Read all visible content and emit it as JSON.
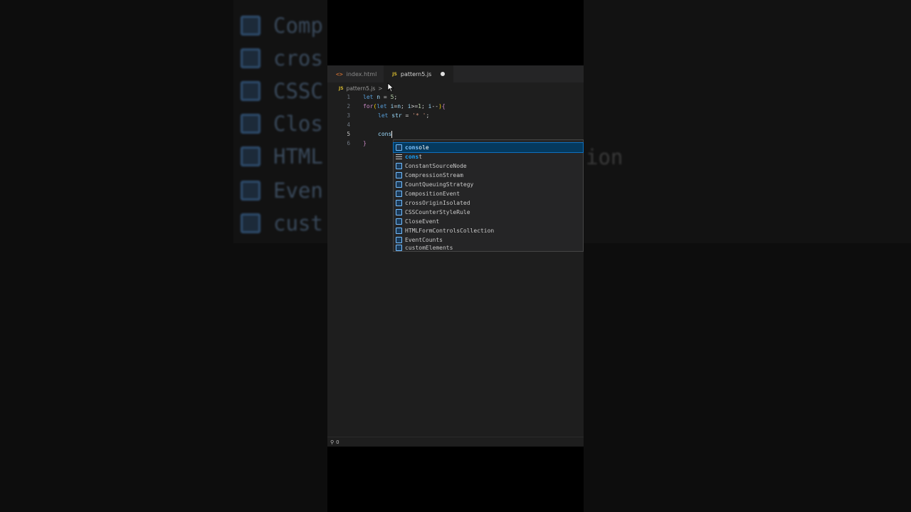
{
  "background_zoom": {
    "items": [
      "Comp",
      "cros",
      "CSSC",
      "Clos",
      "HTML",
      "Even",
      "cust"
    ],
    "trail_text": "ion"
  },
  "tabs": [
    {
      "label": "index.html",
      "icon": "html-icon",
      "active": false
    },
    {
      "label": "pattern5.js",
      "icon": "js-icon",
      "active": true,
      "unsaved": true
    }
  ],
  "breadcrumb": {
    "icon": "JS",
    "file": "pattern5.js",
    "separator": ">"
  },
  "js_icon_text": "JS",
  "code_lines": [
    {
      "num": "1"
    },
    {
      "num": "2"
    },
    {
      "num": "3"
    },
    {
      "num": "4"
    },
    {
      "num": "5"
    },
    {
      "num": "6"
    }
  ],
  "code_tokens": {
    "l1_let": "let",
    "l1_n": "n",
    "l1_eq": " = ",
    "l1_five": "5",
    "l1_semi": ";",
    "l2_for": "for",
    "l2_open": "(",
    "l2_let": "let",
    "l2_i1": "i",
    "l2_eqn": "=",
    "l2_n": "n",
    "l2_s1": "; ",
    "l2_i2": "i",
    "l2_ge": ">=",
    "l2_one": "1",
    "l2_s2": "; ",
    "l2_i3": "i",
    "l2_dec": "--",
    "l2_close": ")",
    "l2_brace": "{",
    "l3_let": "let",
    "l3_str": "str",
    "l3_eq": " = ",
    "l3_val": "'* '",
    "l3_semi": ";",
    "l5_typed": "cons",
    "l6_brace": "}"
  },
  "suggestions": [
    {
      "prefix": "cons",
      "rest": "ole",
      "kind": "variable",
      "selected": true
    },
    {
      "prefix": "cons",
      "rest": "t",
      "kind": "keyword",
      "selected": false
    },
    {
      "label": "ConstantSourceNode",
      "kind": "variable"
    },
    {
      "label": "CompressionStream",
      "kind": "variable"
    },
    {
      "label": "CountQueuingStrategy",
      "kind": "variable"
    },
    {
      "label": "CompositionEvent",
      "kind": "variable"
    },
    {
      "label": "crossOriginIsolated",
      "kind": "variable"
    },
    {
      "label": "CSSCounterStyleRule",
      "kind": "variable"
    },
    {
      "label": "CloseEvent",
      "kind": "variable"
    },
    {
      "label": "HTMLFormControlsCollection",
      "kind": "variable"
    },
    {
      "label": "EventCounts",
      "kind": "variable"
    },
    {
      "label": "customElements",
      "kind": "variable"
    }
  ],
  "status": {
    "ports": "0"
  },
  "colors": {
    "accent": "#0e70c0",
    "keyword": "#569cd6",
    "variable": "#9cdcfe",
    "string": "#ce9178",
    "number": "#b5cea8",
    "bracket": "#ffd700"
  }
}
